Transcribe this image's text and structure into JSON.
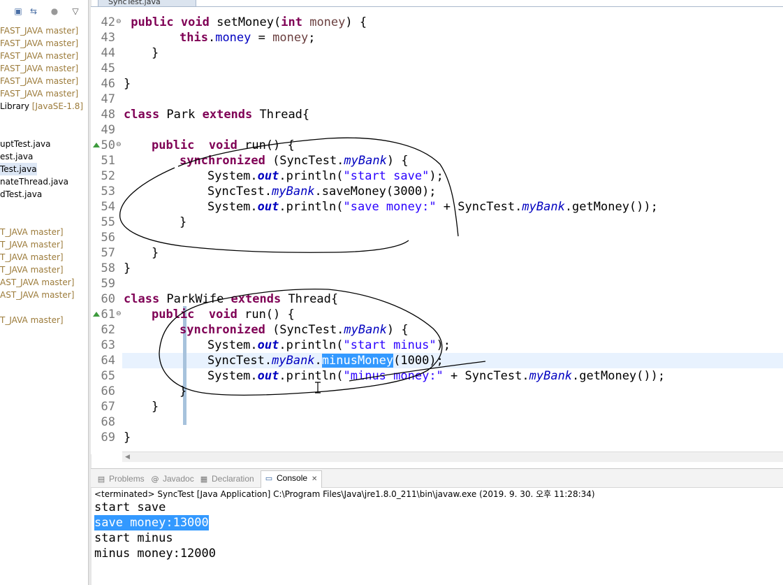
{
  "editor_tab": {
    "label": "SyncTest.java"
  },
  "package_explorer": {
    "items": [
      {
        "text": "FAST_JAVA master]",
        "muted": true
      },
      {
        "text": "FAST_JAVA master]",
        "muted": true
      },
      {
        "text": "FAST_JAVA master]",
        "muted": true
      },
      {
        "text": "FAST_JAVA master]",
        "muted": true
      },
      {
        "text": "FAST_JAVA master]",
        "muted": true
      },
      {
        "text": "FAST_JAVA master]",
        "muted": true
      },
      {
        "text": "Library ",
        "muted_suffix": "[JavaSE-1.8]"
      },
      {
        "text": "uptTest.java"
      },
      {
        "text": "est.java"
      },
      {
        "text": "Test.java",
        "selected": true
      },
      {
        "text": "nateThread.java"
      },
      {
        "text": "dTest.java"
      },
      {
        "text": "T_JAVA master]",
        "muted": true
      },
      {
        "text": "T_JAVA master]",
        "muted": true
      },
      {
        "text": "T_JAVA master]",
        "muted": true
      },
      {
        "text": "T_JAVA master]",
        "muted": true
      },
      {
        "text": "AST_JAVA master]",
        "muted": true
      },
      {
        "text": "AST_JAVA master]",
        "muted": true
      },
      {
        "text": "T_JAVA master]",
        "muted": true
      }
    ]
  },
  "code_lines": [
    {
      "n": "42",
      "fold": true
    },
    {
      "n": "43"
    },
    {
      "n": "44"
    },
    {
      "n": "45"
    },
    {
      "n": "46"
    },
    {
      "n": "47"
    },
    {
      "n": "48"
    },
    {
      "n": "49"
    },
    {
      "n": "50",
      "fold": true,
      "override": true
    },
    {
      "n": "51"
    },
    {
      "n": "52"
    },
    {
      "n": "53"
    },
    {
      "n": "54"
    },
    {
      "n": "55"
    },
    {
      "n": "56"
    },
    {
      "n": "57"
    },
    {
      "n": "58"
    },
    {
      "n": "59"
    },
    {
      "n": "60"
    },
    {
      "n": "61",
      "fold": true,
      "override": true
    },
    {
      "n": "62"
    },
    {
      "n": "63"
    },
    {
      "n": "64"
    },
    {
      "n": "65"
    },
    {
      "n": "66"
    },
    {
      "n": "67"
    },
    {
      "n": "68"
    },
    {
      "n": "69"
    }
  ],
  "code": {
    "l42": [
      " ",
      "public",
      " ",
      "void",
      " setMoney(",
      "int",
      " ",
      "money",
      ") {"
    ],
    "l43": [
      "this",
      ".",
      "money",
      " = ",
      "money",
      ";"
    ],
    "l44": "}",
    "l46": "}",
    "l48": [
      "class",
      " Park ",
      "extends",
      " Thread{"
    ],
    "l50": [
      "public",
      "  ",
      "void",
      " run() {"
    ],
    "l51": [
      "synchronized",
      " (SyncTest.",
      "myBank",
      ") {"
    ],
    "l52": [
      "System.",
      "out",
      ".println(",
      "\"start save\"",
      ");"
    ],
    "l53": [
      "SyncTest.",
      "myBank",
      ".saveMoney(3000);"
    ],
    "l54": [
      "System.",
      "out",
      ".println(",
      "\"save money:\"",
      " + SyncTest.",
      "myBank",
      ".getMoney());"
    ],
    "l55": "}",
    "l57": "}",
    "l58": "}",
    "l60": [
      "class",
      " ParkWife ",
      "extends",
      " Thread{"
    ],
    "l61": [
      "public",
      "  ",
      "void",
      " run() {"
    ],
    "l62": [
      "synchronized",
      " (SyncTest.",
      "myBank",
      ") {"
    ],
    "l63": [
      "System.",
      "out",
      ".println(",
      "\"start minus\"",
      ");"
    ],
    "l64": [
      "SyncTest.",
      "myBank",
      ".",
      "minusMoney",
      "(1000);"
    ],
    "l65": [
      "System.",
      "out",
      ".println(",
      "\"minus money:\"",
      " + SyncTest.",
      "myBank",
      ".getMoney());"
    ],
    "l66": "}",
    "l67": "}",
    "l69": "}"
  },
  "views": {
    "tabs": [
      {
        "label": "Problems",
        "icon": "problems-icon"
      },
      {
        "label": "Javadoc",
        "icon": "at-icon"
      },
      {
        "label": "Declaration",
        "icon": "declaration-icon"
      },
      {
        "label": "Console",
        "icon": "console-icon",
        "active": true
      }
    ],
    "close_glyph": "✕"
  },
  "console": {
    "header": "<terminated> SyncTest [Java Application] C:\\Program Files\\Java\\jre1.8.0_211\\bin\\javaw.exe (2019. 9. 30. 오후 11:28:34)",
    "lines": [
      {
        "text": "start save"
      },
      {
        "text": "save money:13000",
        "selected": true
      },
      {
        "text": "start minus"
      },
      {
        "text": "minus money:12000"
      }
    ]
  },
  "colors": {
    "keyword": "#7f0055",
    "field": "#0000c0",
    "string": "#2a00ff",
    "selection": "#3399ff",
    "current_line": "#e8f2fe"
  }
}
